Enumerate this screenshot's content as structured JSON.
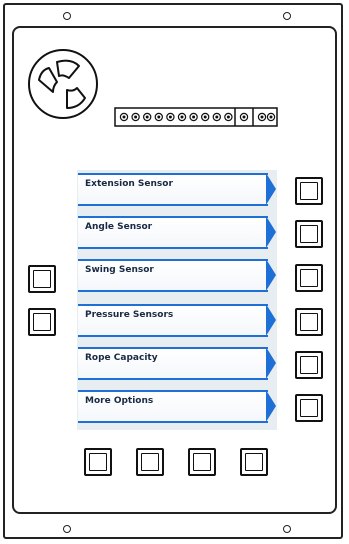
{
  "panel": {
    "menu": [
      {
        "label": "Extension Sensor"
      },
      {
        "label": "Angle Sensor"
      },
      {
        "label": "Swing Sensor"
      },
      {
        "label": "Pressure Sensors"
      },
      {
        "label": "Rope Capacity"
      },
      {
        "label": "More Options"
      }
    ],
    "accent_color": "#1e6fd6",
    "connector_pins": 13
  }
}
